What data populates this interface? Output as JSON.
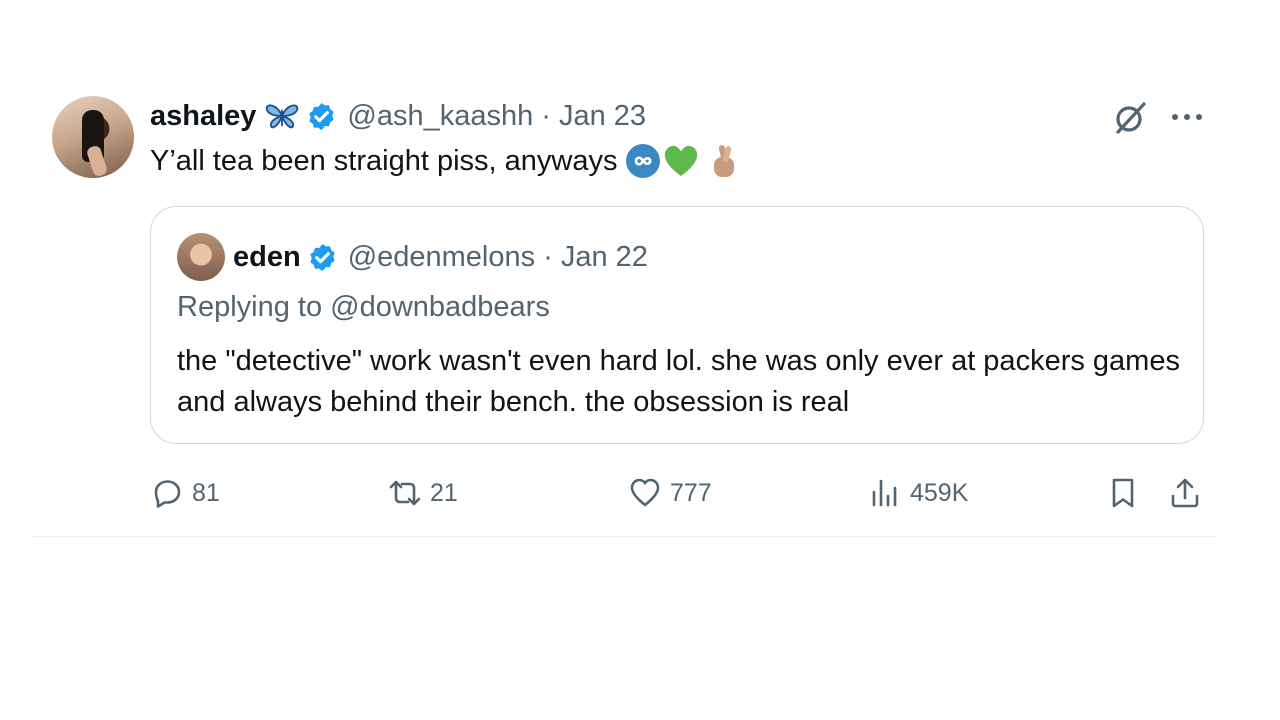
{
  "post": {
    "author_name": "ashaley",
    "author_handle": "@ash_kaashh",
    "separator": "·",
    "date": "Jan 23",
    "text": "Y’all tea been straight piss, anyways",
    "author_emoji": "butterfly-icon",
    "text_emojis": [
      "infinity-emoji",
      "green-heart-emoji",
      "crossed-fingers-emoji"
    ]
  },
  "quote": {
    "author_name": "eden",
    "author_handle": "@edenmelons",
    "separator": "·",
    "date": "Jan 22",
    "replying_to": "Replying to @downbadbears",
    "text": "the \"detective\" work wasn't even hard lol. she was only ever at packers games and always behind their bench. the obsession is real"
  },
  "actions": {
    "replies": "81",
    "reposts": "21",
    "likes": "777",
    "views": "459K"
  },
  "colors": {
    "verified": "#1d9bf0",
    "secondary_text": "#536471",
    "border": "#cfd9de",
    "green_heart": "#5fb84a"
  }
}
